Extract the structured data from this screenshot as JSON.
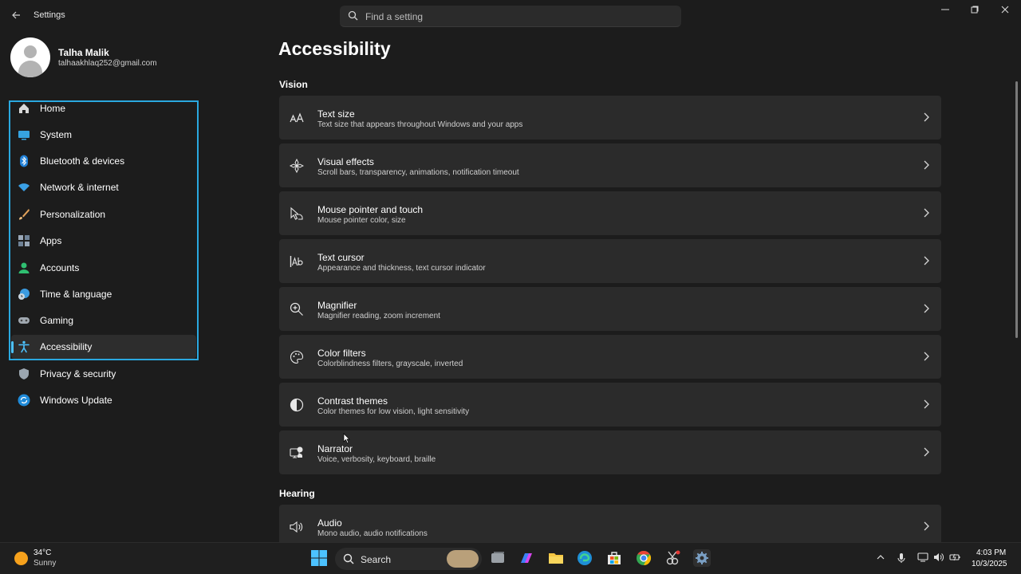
{
  "window": {
    "app_title": "Settings",
    "search_placeholder": "Find a setting"
  },
  "user": {
    "name": "Talha Malik",
    "email": "talhaakhlaq252@gmail.com"
  },
  "sidebar": {
    "items": [
      {
        "label": "Home",
        "icon": "home-icon"
      },
      {
        "label": "System",
        "icon": "system-icon"
      },
      {
        "label": "Bluetooth & devices",
        "icon": "bluetooth-icon"
      },
      {
        "label": "Network & internet",
        "icon": "wifi-icon"
      },
      {
        "label": "Personalization",
        "icon": "brush-icon"
      },
      {
        "label": "Apps",
        "icon": "apps-icon"
      },
      {
        "label": "Accounts",
        "icon": "accounts-icon"
      },
      {
        "label": "Time & language",
        "icon": "globe-clock-icon"
      },
      {
        "label": "Gaming",
        "icon": "gamepad-icon"
      },
      {
        "label": "Accessibility",
        "icon": "accessibility-icon",
        "active": true
      },
      {
        "label": "Privacy & security",
        "icon": "shield-icon"
      },
      {
        "label": "Windows Update",
        "icon": "update-icon"
      }
    ]
  },
  "main": {
    "title": "Accessibility",
    "sections": [
      {
        "title": "Vision",
        "items": [
          {
            "title": "Text size",
            "subtitle": "Text size that appears throughout Windows and your apps",
            "icon": "text-size-icon"
          },
          {
            "title": "Visual effects",
            "subtitle": "Scroll bars, transparency, animations, notification timeout",
            "icon": "visual-effects-icon"
          },
          {
            "title": "Mouse pointer and touch",
            "subtitle": "Mouse pointer color, size",
            "icon": "mouse-pointer-icon"
          },
          {
            "title": "Text cursor",
            "subtitle": "Appearance and thickness, text cursor indicator",
            "icon": "text-cursor-icon"
          },
          {
            "title": "Magnifier",
            "subtitle": "Magnifier reading, zoom increment",
            "icon": "magnifier-icon"
          },
          {
            "title": "Color filters",
            "subtitle": "Colorblindness filters, grayscale, inverted",
            "icon": "color-filters-icon"
          },
          {
            "title": "Contrast themes",
            "subtitle": "Color themes for low vision, light sensitivity",
            "icon": "contrast-icon"
          },
          {
            "title": "Narrator",
            "subtitle": "Voice, verbosity, keyboard, braille",
            "icon": "narrator-icon"
          }
        ]
      },
      {
        "title": "Hearing",
        "items": [
          {
            "title": "Audio",
            "subtitle": "Mono audio, audio notifications",
            "icon": "audio-icon"
          }
        ]
      }
    ]
  },
  "taskbar": {
    "weather": {
      "temp": "34°C",
      "condition": "Sunny"
    },
    "search_label": "Search",
    "clock": {
      "time": "4:03 PM",
      "date": "10/3/2025"
    }
  }
}
